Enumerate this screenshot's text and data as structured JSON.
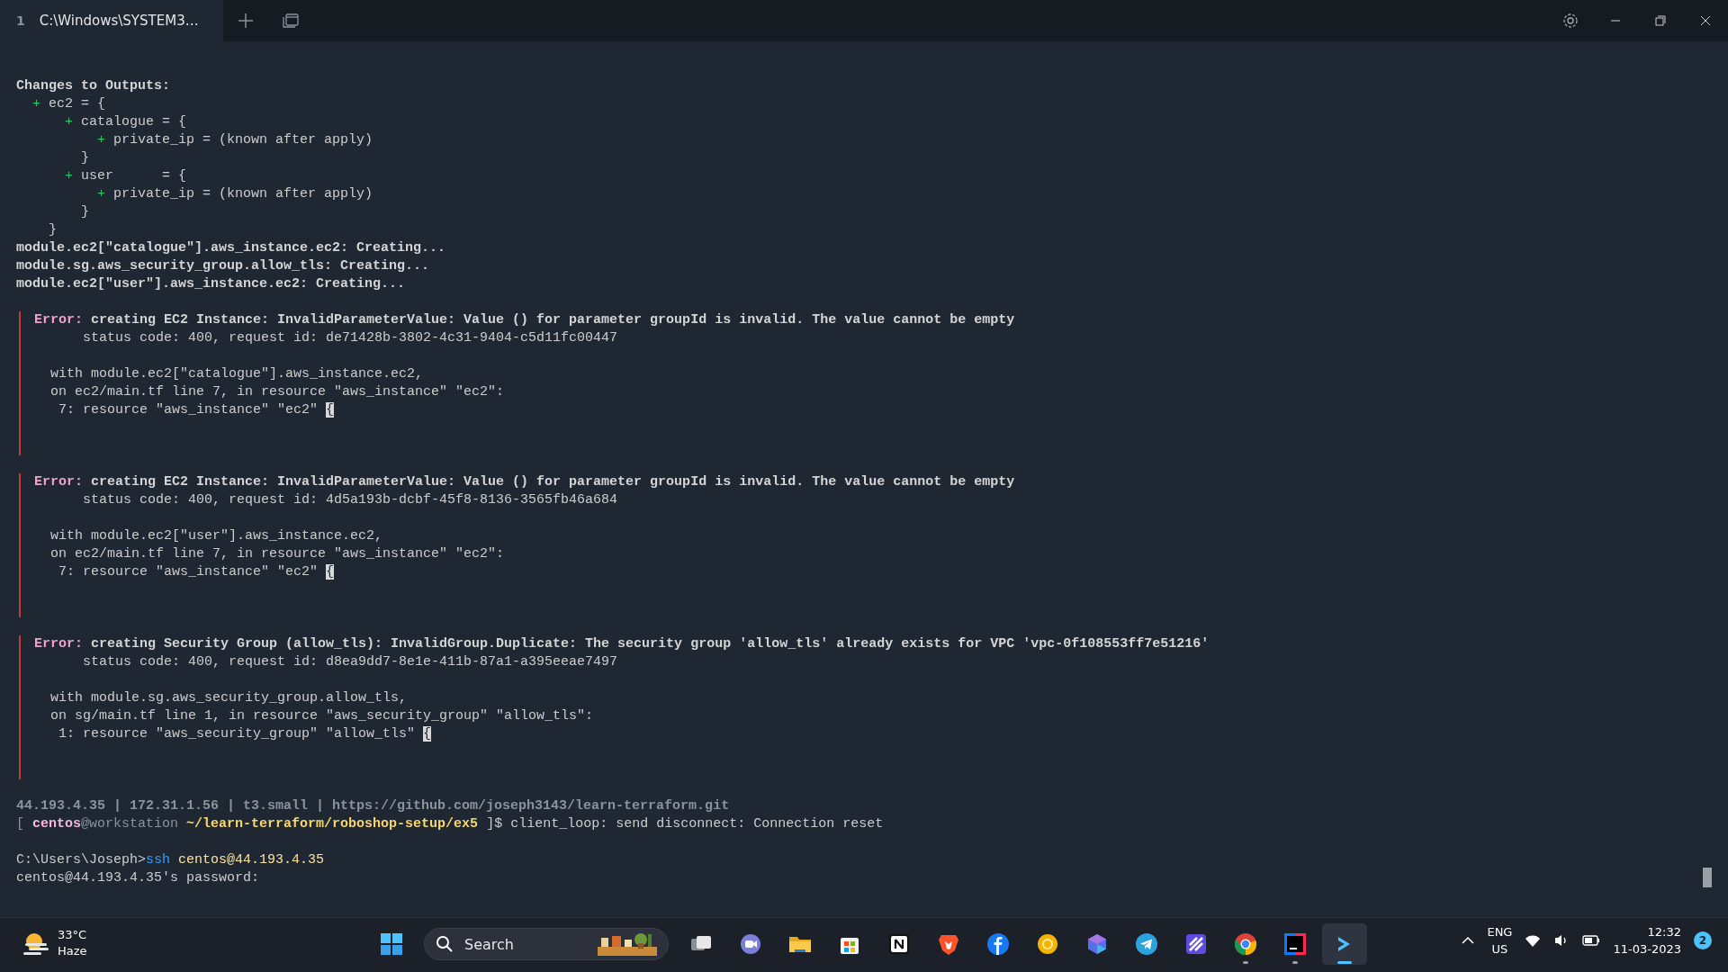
{
  "tab_bar": {
    "tabs": [
      {
        "number": "1",
        "title": "C:\\Windows\\SYSTEM3…",
        "selected": true
      }
    ]
  },
  "terminal": {
    "blocks": [
      {
        "kind": "plain",
        "lines": [
          {
            "kind": "text",
            "segments": [
              {
                "text": "Changes to Outputs:",
                "kind": "bold"
              }
            ]
          },
          {
            "kind": "text",
            "segments": [
              {
                "text": "  +",
                "kind": "green"
              },
              {
                "text": " ec2 = {",
                "kind": "plain"
              }
            ]
          },
          {
            "kind": "text",
            "segments": [
              {
                "text": "      +",
                "kind": "green"
              },
              {
                "text": " catalogue = {",
                "kind": "plain"
              }
            ]
          },
          {
            "kind": "text",
            "segments": [
              {
                "text": "          +",
                "kind": "green"
              },
              {
                "text": " private_ip = (known after apply)",
                "kind": "plain"
              }
            ]
          },
          {
            "kind": "text",
            "segments": [
              {
                "text": "        }",
                "kind": "plain"
              }
            ]
          },
          {
            "kind": "text",
            "segments": [
              {
                "text": "      +",
                "kind": "green"
              },
              {
                "text": " user      = {",
                "kind": "plain"
              }
            ]
          },
          {
            "kind": "text",
            "segments": [
              {
                "text": "          +",
                "kind": "green"
              },
              {
                "text": " private_ip = (known after apply)",
                "kind": "plain"
              }
            ]
          },
          {
            "kind": "text",
            "segments": [
              {
                "text": "        }",
                "kind": "plain"
              }
            ]
          },
          {
            "kind": "text",
            "segments": [
              {
                "text": "    }",
                "kind": "plain"
              }
            ]
          },
          {
            "kind": "text",
            "segments": [
              {
                "text": "module.ec2[\"catalogue\"].aws_instance.ec2: Creating...",
                "kind": "bold"
              }
            ]
          },
          {
            "kind": "text",
            "segments": [
              {
                "text": "module.sg.aws_security_group.allow_tls: Creating...",
                "kind": "bold"
              }
            ]
          },
          {
            "kind": "text",
            "segments": [
              {
                "text": "module.ec2[\"user\"].aws_instance.ec2: Creating...",
                "kind": "bold"
              }
            ]
          },
          {
            "kind": "blank"
          }
        ]
      },
      {
        "kind": "error",
        "lines": [
          {
            "kind": "text",
            "segments": [
              {
                "text": "Error:",
                "kind": "error-label"
              },
              {
                "text": " creating EC2 Instance: InvalidParameterValue: Value () for parameter groupId is invalid. The value cannot be empty",
                "kind": "bold"
              }
            ]
          },
          {
            "kind": "text",
            "segments": [
              {
                "text": "      status code: 400, request id: de71428b-3802-4c31-9404-c5d11fc00447",
                "kind": "plain"
              }
            ]
          },
          {
            "kind": "blank"
          },
          {
            "kind": "text",
            "segments": [
              {
                "text": "  with module.ec2[\"catalogue\"].aws_instance.ec2,",
                "kind": "plain"
              }
            ]
          },
          {
            "kind": "text",
            "segments": [
              {
                "text": "  on ec2/main.tf line 7, in resource \"aws_instance\" \"ec2\":",
                "kind": "plain"
              }
            ]
          },
          {
            "kind": "text",
            "segments": [
              {
                "text": "   7: resource \"aws_instance\" \"ec2\" ",
                "kind": "plain"
              },
              {
                "text": "{",
                "kind": "cursor"
              }
            ]
          },
          {
            "kind": "blank"
          },
          {
            "kind": "blank"
          }
        ]
      },
      {
        "kind": "error",
        "lines": [
          {
            "kind": "text",
            "segments": [
              {
                "text": "Error:",
                "kind": "error-label"
              },
              {
                "text": " creating EC2 Instance: InvalidParameterValue: Value () for parameter groupId is invalid. The value cannot be empty",
                "kind": "bold"
              }
            ]
          },
          {
            "kind": "text",
            "segments": [
              {
                "text": "      status code: 400, request id: 4d5a193b-dcbf-45f8-8136-3565fb46a684",
                "kind": "plain"
              }
            ]
          },
          {
            "kind": "blank"
          },
          {
            "kind": "text",
            "segments": [
              {
                "text": "  with module.ec2[\"user\"].aws_instance.ec2,",
                "kind": "plain"
              }
            ]
          },
          {
            "kind": "text",
            "segments": [
              {
                "text": "  on ec2/main.tf line 7, in resource \"aws_instance\" \"ec2\":",
                "kind": "plain"
              }
            ]
          },
          {
            "kind": "text",
            "segments": [
              {
                "text": "   7: resource \"aws_instance\" \"ec2\" ",
                "kind": "plain"
              },
              {
                "text": "{",
                "kind": "cursor"
              }
            ]
          },
          {
            "kind": "blank"
          },
          {
            "kind": "blank"
          }
        ]
      },
      {
        "kind": "error",
        "lines": [
          {
            "kind": "text",
            "segments": [
              {
                "text": "Error:",
                "kind": "error-label"
              },
              {
                "text": " creating Security Group (allow_tls): InvalidGroup.Duplicate: The security group 'allow_tls' already exists for VPC 'vpc-0f108553ff7e51216'",
                "kind": "bold"
              }
            ]
          },
          {
            "kind": "text",
            "segments": [
              {
                "text": "      status code: 400, request id: d8ea9dd7-8e1e-411b-87a1-a395eeae7497",
                "kind": "plain"
              }
            ]
          },
          {
            "kind": "blank"
          },
          {
            "kind": "text",
            "segments": [
              {
                "text": "  with module.sg.aws_security_group.allow_tls,",
                "kind": "plain"
              }
            ]
          },
          {
            "kind": "text",
            "segments": [
              {
                "text": "  on sg/main.tf line 1, in resource \"aws_security_group\" \"allow_tls\":",
                "kind": "plain"
              }
            ]
          },
          {
            "kind": "text",
            "segments": [
              {
                "text": "   1: resource \"aws_security_group\" \"allow_tls\" ",
                "kind": "plain"
              },
              {
                "text": "{",
                "kind": "cursor"
              }
            ]
          },
          {
            "kind": "blank"
          },
          {
            "kind": "blank"
          }
        ]
      },
      {
        "kind": "plain",
        "lines": [
          {
            "kind": "text",
            "segments": [
              {
                "text": "44.193.4.35 | 172.31.1.56 | t3.small | https://github.com/joseph3143/learn-terraform.git",
                "kind": "dim-bold"
              }
            ]
          },
          {
            "kind": "text",
            "segments": [
              {
                "text": "[ ",
                "kind": "dim"
              },
              {
                "text": "centos",
                "kind": "user"
              },
              {
                "text": "@workstation ",
                "kind": "dim"
              },
              {
                "text": "~/learn-terraform/roboshop-setup/ex5",
                "kind": "path"
              },
              {
                "text": " ]$ client_loop: send disconnect: Connection reset",
                "kind": "plain"
              }
            ]
          },
          {
            "kind": "blank"
          },
          {
            "kind": "text",
            "segments": [
              {
                "text": "C:\\Users\\Joseph>",
                "kind": "plain"
              },
              {
                "text": "ssh",
                "kind": "cmd"
              },
              {
                "text": " centos@44.193.4.35",
                "kind": "arg"
              }
            ]
          },
          {
            "kind": "text",
            "segments": [
              {
                "text": "centos@44.193.4.35's password:",
                "kind": "plain"
              }
            ]
          }
        ]
      }
    ]
  },
  "taskbar": {
    "weather": {
      "temperature": "33°C",
      "condition": "Haze"
    },
    "search": {
      "placeholder": "Search"
    },
    "apps": [
      {
        "kind": "task-view",
        "running": false,
        "active": false
      },
      {
        "kind": "chat",
        "running": false,
        "active": false
      },
      {
        "kind": "folder",
        "running": false,
        "active": false
      },
      {
        "kind": "store",
        "running": false,
        "active": false
      },
      {
        "kind": "notes",
        "running": false,
        "active": false
      },
      {
        "kind": "lion",
        "running": false,
        "active": false
      },
      {
        "kind": "social",
        "running": false,
        "active": false
      },
      {
        "kind": "ring",
        "running": false,
        "active": false
      },
      {
        "kind": "hexagon",
        "running": false,
        "active": false
      },
      {
        "kind": "plane",
        "running": false,
        "active": false
      },
      {
        "kind": "stripes",
        "running": false,
        "active": false
      },
      {
        "kind": "browser",
        "running": true,
        "active": false
      },
      {
        "kind": "ide",
        "running": true,
        "active": false
      },
      {
        "kind": "terminal",
        "running": true,
        "active": true
      }
    ],
    "language": {
      "primary": "ENG",
      "secondary": "US"
    },
    "clock": {
      "time": "12:32",
      "date": "11-03-2023"
    },
    "notifications": "2"
  }
}
